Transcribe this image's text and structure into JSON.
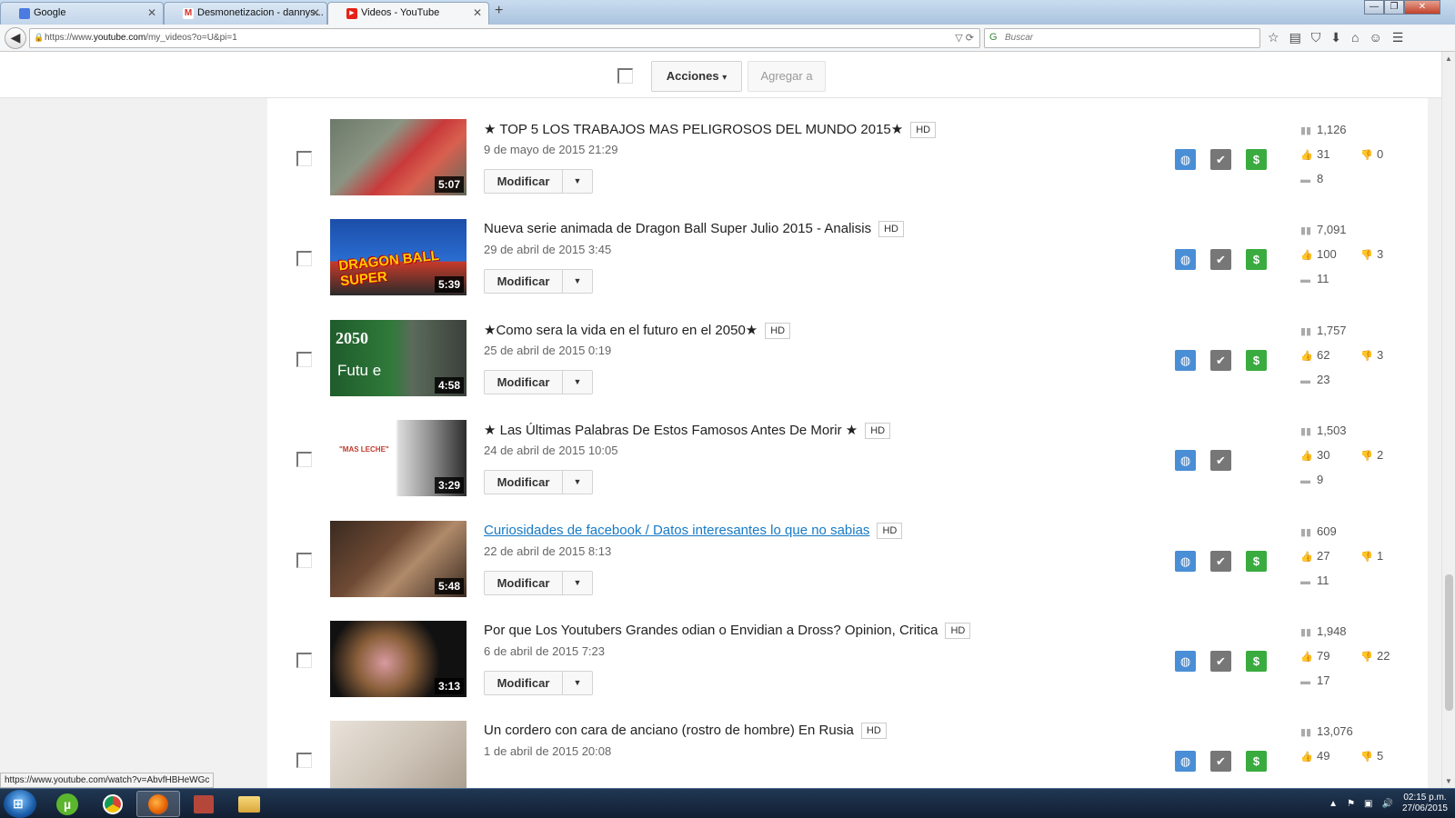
{
  "browser": {
    "tabs": [
      {
        "label": "Google",
        "favicon_color": "#4a7be0",
        "favicon_glyph": "g"
      },
      {
        "label": "Desmonetizacion - dannys...",
        "favicon_color": "#d93025",
        "favicon_glyph": "M"
      },
      {
        "label": "Videos - YouTube",
        "favicon_color": "#e62117",
        "favicon_glyph": "▶"
      }
    ],
    "new_tab_icon": "+",
    "window_controls": {
      "minimize": "—",
      "restore": "❐",
      "close": "✕"
    },
    "back_icon": "◀",
    "url": {
      "prefix": "https://www.",
      "host": "youtube.com",
      "path": "/my_videos?o=U&pi=1"
    },
    "url_icons": "▽ ⟳",
    "search_placeholder": "Buscar",
    "toolbar_icons": [
      "☆",
      "▤",
      "⛉",
      "⬇",
      "⌂",
      "☺",
      "☰"
    ]
  },
  "actions": {
    "acciones_label": "Acciones",
    "agregar_label": "Agregar a",
    "caret": "▾"
  },
  "colors": {
    "public": "#4a8ed6",
    "ok": "#777777",
    "monetized": "#3aab3f",
    "link": "#167ac6"
  },
  "videos": [
    {
      "title": "★ TOP 5 LOS TRABAJOS MAS PELIGROSOS DEL MUNDO 2015★",
      "hd": "HD",
      "date": "9 de mayo de 2015 21:29",
      "duration": "5:07",
      "modify": "Modificar",
      "views": "1,126",
      "likes": "31",
      "dislikes": "0",
      "comments": "8",
      "monetized": true,
      "link": false,
      "thumb": "croc"
    },
    {
      "title": "Nueva serie animada de Dragon Ball Super Julio 2015 - Analisis",
      "hd": "HD",
      "date": "29 de abril de 2015 3:45",
      "duration": "5:39",
      "modify": "Modificar",
      "views": "7,091",
      "likes": "100",
      "dislikes": "3",
      "comments": "11",
      "monetized": true,
      "link": false,
      "thumb": "dbz",
      "thumb_text": "DRAGON BALL SUPER"
    },
    {
      "title": "★Como sera la vida en el futuro en el 2050★",
      "hd": "HD",
      "date": "25 de abril de 2015 0:19",
      "duration": "4:58",
      "modify": "Modificar",
      "views": "1,757",
      "likes": "62",
      "dislikes": "3",
      "comments": "23",
      "monetized": true,
      "link": false,
      "thumb": "future",
      "thumb_text": "2050",
      "thumb_text2": "Futu e"
    },
    {
      "title": "★ Las Últimas Palabras De Estos Famosos Antes De Morir ★",
      "hd": "HD",
      "date": "24 de abril de 2015 10:05",
      "duration": "3:29",
      "modify": "Modificar",
      "views": "1,503",
      "likes": "30",
      "dislikes": "2",
      "comments": "9",
      "monetized": false,
      "link": false,
      "thumb": "words",
      "thumb_text": "\"MAS LECHE\""
    },
    {
      "title": "Curiosidades de facebook / Datos interesantes lo que no sabias",
      "hd": "HD",
      "date": "22 de abril de 2015 8:13",
      "duration": "5:48",
      "modify": "Modificar",
      "views": "609",
      "likes": "27",
      "dislikes": "1",
      "comments": "11",
      "monetized": true,
      "link": true,
      "thumb": "fb"
    },
    {
      "title": "Por que Los Youtubers Grandes odian o Envidian a Dross? Opinion, Critica",
      "hd": "HD",
      "date": "6 de abril de 2015 7:23",
      "duration": "3:13",
      "modify": "Modificar",
      "views": "1,948",
      "likes": "79",
      "dislikes": "22",
      "comments": "17",
      "monetized": true,
      "link": false,
      "thumb": "dross"
    },
    {
      "title": "Un cordero con cara de anciano (rostro de hombre) En Rusia",
      "hd": "HD",
      "date": "1 de abril de 2015 20:08",
      "duration": "",
      "modify": "Modificar",
      "views": "13,076",
      "likes": "49",
      "dislikes": "5",
      "comments": "",
      "monetized": true,
      "link": false,
      "thumb": "lamb"
    }
  ],
  "icons": {
    "public": "public-globe-icon",
    "ok": "check-icon",
    "monetized": "dollar-icon",
    "views": "bar-chart-icon",
    "likes": "thumbs-up-icon",
    "dislikes": "thumbs-down-icon",
    "comments": "comment-icon"
  },
  "status_url": "https://www.youtube.com/watch?v=AbvfHBHeWGc",
  "taskbar": {
    "time": "02:15 p.m.",
    "date": "27/06/2015"
  }
}
